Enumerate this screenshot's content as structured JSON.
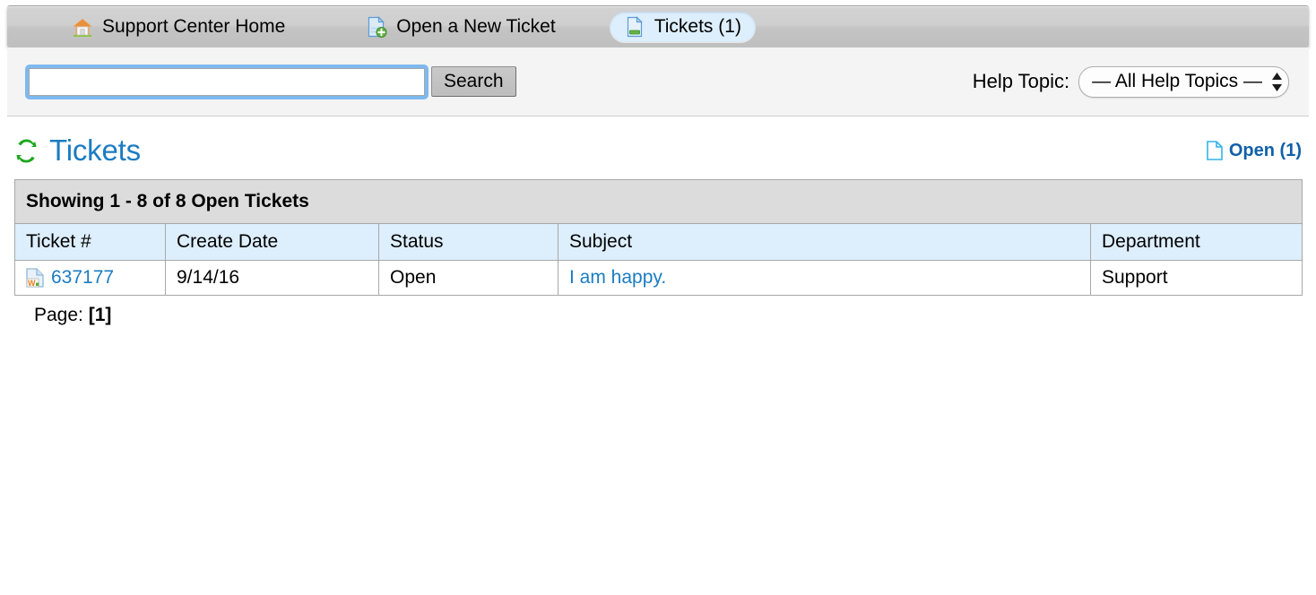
{
  "nav": {
    "items": [
      {
        "label": "Support Center Home",
        "icon": "home-icon",
        "active": false
      },
      {
        "label": "Open a New Ticket",
        "icon": "new-document-icon",
        "active": false
      },
      {
        "label": "Tickets (1)",
        "icon": "document-icon",
        "active": true
      }
    ]
  },
  "search": {
    "value": "",
    "placeholder": "",
    "button_label": "Search",
    "help_topic_label": "Help Topic:",
    "help_topic_selected": "— All Help Topics —",
    "help_topic_options": [
      "— All Help Topics —"
    ]
  },
  "heading": {
    "title": "Tickets",
    "refresh_icon": "refresh-icon",
    "open_link_label": "Open (1)",
    "open_link_icon": "page-icon"
  },
  "table": {
    "caption": "Showing 1 - 8 of 8 Open Tickets",
    "columns": [
      "Ticket #",
      "Create Date",
      "Status",
      "Subject",
      "Department"
    ],
    "rows": [
      {
        "ticket_number": "637177",
        "ticket_icon": "word-document-icon",
        "create_date": "9/14/16",
        "status": "Open",
        "subject": "I am happy.",
        "department": "Support"
      }
    ]
  },
  "pagination": {
    "label": "Page:",
    "current": "[1]"
  },
  "colors": {
    "link_blue": "#1b7cc2",
    "header_blue": "#ddeefc",
    "accent_green": "#22a722",
    "caption_gray": "#dcdcdc"
  }
}
